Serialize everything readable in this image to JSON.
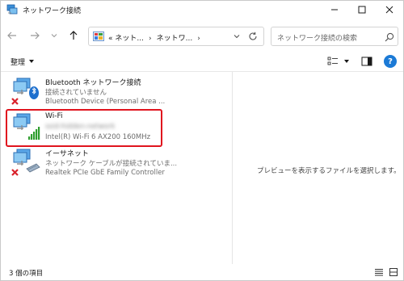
{
  "window": {
    "title": "ネットワーク接続",
    "buttons": {
      "minimize": "–",
      "maximize": "☐",
      "close": "✕"
    }
  },
  "navigation": {
    "back_icon": "arrow-left-icon",
    "forward_icon": "arrow-right-icon",
    "recent_icon": "chevron-down-icon",
    "up_icon": "arrow-up-icon"
  },
  "address": {
    "prefix": "«",
    "crumbs": [
      "ネット...",
      "ネットワ..."
    ],
    "separator": "›"
  },
  "search": {
    "placeholder": "ネットワーク接続の検索"
  },
  "commandbar": {
    "organize_label": "整理",
    "help_label": "?"
  },
  "items": [
    {
      "name": "Bluetooth ネットワーク接続",
      "status": "接続されていません",
      "device": "Bluetooth Device (Personal Area ..."
    },
    {
      "name": "Wi-Fi",
      "status": "ssid-hidden-network",
      "device": "Intel(R) Wi-Fi 6 AX200 160MHz"
    },
    {
      "name": "イーサネット",
      "status": "ネットワーク ケーブルが接続されていま...",
      "device": "Realtek PCIe GbE Family Controller"
    }
  ],
  "preview": {
    "message": "プレビューを表示するファイルを選択します。"
  },
  "statusbar": {
    "count": "3 個の項目"
  },
  "colors": {
    "highlight": "#e0141e",
    "accent": "#1b7ad6",
    "error_x": "#d9232d",
    "signal": "#2f9e2f"
  }
}
